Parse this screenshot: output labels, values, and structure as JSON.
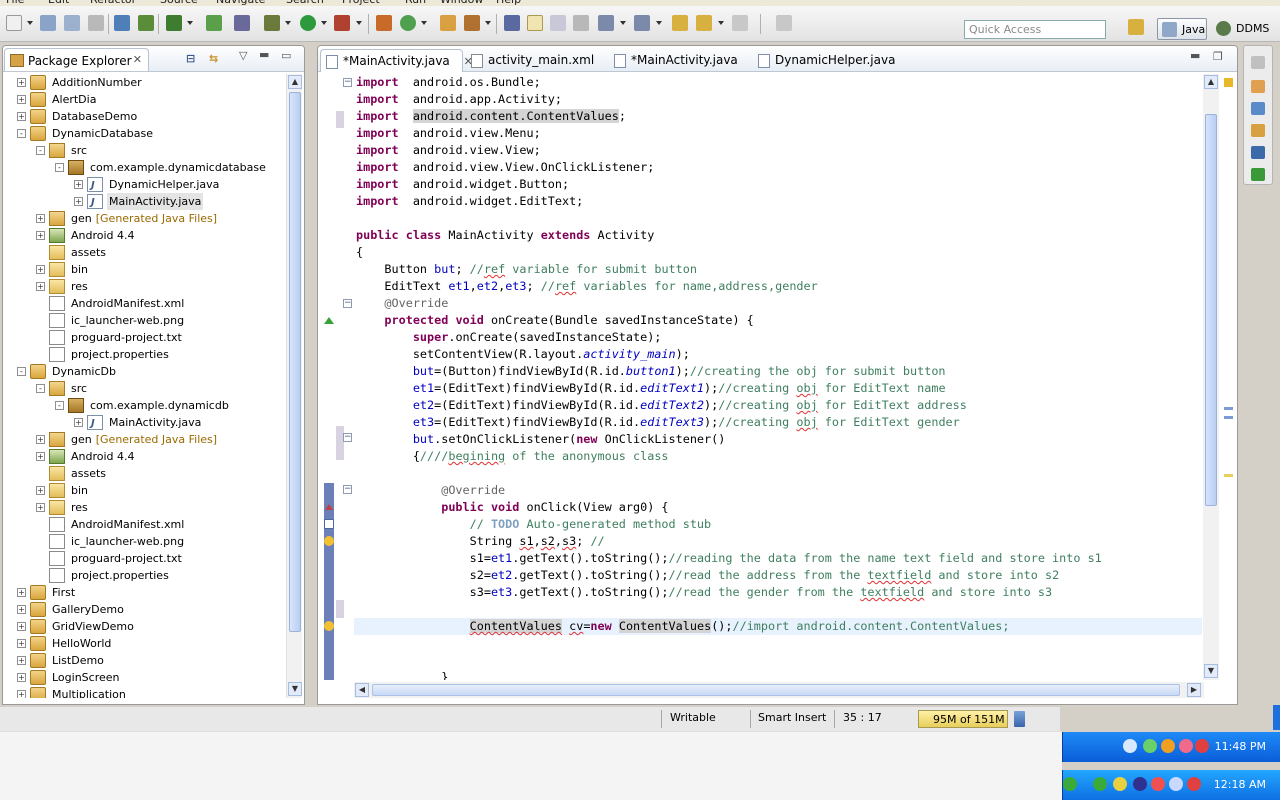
{
  "menubar": {
    "items": [
      "File",
      "Edit",
      "Refactor",
      "Source",
      "Navigate",
      "Search",
      "Project",
      "Run",
      "Window",
      "Help"
    ]
  },
  "toolbar": {
    "quick_access_placeholder": "Quick Access",
    "perspectives": [
      {
        "label": "Java"
      },
      {
        "label": "DDMS"
      }
    ]
  },
  "package_explorer": {
    "title": "Package Explorer",
    "rows": [
      {
        "label": "AdditionNumber",
        "indent": 0,
        "expander": "+",
        "icon": "project-icon"
      },
      {
        "label": "AlertDia",
        "indent": 0,
        "expander": "+",
        "icon": "project-icon"
      },
      {
        "label": "DatabaseDemo",
        "indent": 0,
        "expander": "+",
        "icon": "project-icon"
      },
      {
        "label": "DynamicDatabase",
        "indent": 0,
        "expander": "-",
        "icon": "project-icon"
      },
      {
        "label": "src",
        "indent": 1,
        "expander": "-",
        "icon": "source-folder-icon"
      },
      {
        "label": "com.example.dynamicdatabase",
        "indent": 2,
        "expander": "-",
        "icon": "package-icon"
      },
      {
        "label": "DynamicHelper.java",
        "indent": 3,
        "expander": "+",
        "icon": "java-file-icon"
      },
      {
        "label": "MainActivity.java",
        "indent": 3,
        "expander": "+",
        "icon": "java-file-icon",
        "selected": true
      },
      {
        "label": "gen",
        "extra": "[Generated Java Files]",
        "indent": 1,
        "expander": "+",
        "icon": "source-folder-icon"
      },
      {
        "label": "Android 4.4",
        "indent": 1,
        "expander": "+",
        "icon": "library-icon"
      },
      {
        "label": "assets",
        "indent": 1,
        "expander": "",
        "icon": "folder-icon"
      },
      {
        "label": "bin",
        "indent": 1,
        "expander": "+",
        "icon": "folder-icon"
      },
      {
        "label": "res",
        "indent": 1,
        "expander": "+",
        "icon": "folder-icon"
      },
      {
        "label": "AndroidManifest.xml",
        "indent": 1,
        "expander": "",
        "icon": "xml-file-icon"
      },
      {
        "label": "ic_launcher-web.png",
        "indent": 1,
        "expander": "",
        "icon": "image-file-icon"
      },
      {
        "label": "proguard-project.txt",
        "indent": 1,
        "expander": "",
        "icon": "text-file-icon"
      },
      {
        "label": "project.properties",
        "indent": 1,
        "expander": "",
        "icon": "text-file-icon"
      },
      {
        "label": "DynamicDb",
        "indent": 0,
        "expander": "-",
        "icon": "project-icon"
      },
      {
        "label": "src",
        "indent": 1,
        "expander": "-",
        "icon": "source-folder-icon"
      },
      {
        "label": "com.example.dynamicdb",
        "indent": 2,
        "expander": "-",
        "icon": "package-icon"
      },
      {
        "label": "MainActivity.java",
        "indent": 3,
        "expander": "+",
        "icon": "java-file-icon"
      },
      {
        "label": "gen",
        "extra": "[Generated Java Files]",
        "indent": 1,
        "expander": "+",
        "icon": "source-folder-icon"
      },
      {
        "label": "Android 4.4",
        "indent": 1,
        "expander": "+",
        "icon": "library-icon"
      },
      {
        "label": "assets",
        "indent": 1,
        "expander": "",
        "icon": "folder-icon"
      },
      {
        "label": "bin",
        "indent": 1,
        "expander": "+",
        "icon": "folder-icon"
      },
      {
        "label": "res",
        "indent": 1,
        "expander": "+",
        "icon": "folder-icon"
      },
      {
        "label": "AndroidManifest.xml",
        "indent": 1,
        "expander": "",
        "icon": "xml-file-icon"
      },
      {
        "label": "ic_launcher-web.png",
        "indent": 1,
        "expander": "",
        "icon": "image-file-icon"
      },
      {
        "label": "proguard-project.txt",
        "indent": 1,
        "expander": "",
        "icon": "text-file-icon"
      },
      {
        "label": "project.properties",
        "indent": 1,
        "expander": "",
        "icon": "text-file-icon"
      },
      {
        "label": "First",
        "indent": 0,
        "expander": "+",
        "icon": "project-icon"
      },
      {
        "label": "GalleryDemo",
        "indent": 0,
        "expander": "+",
        "icon": "project-icon"
      },
      {
        "label": "GridViewDemo",
        "indent": 0,
        "expander": "+",
        "icon": "project-icon"
      },
      {
        "label": "HelloWorld",
        "indent": 0,
        "expander": "+",
        "icon": "project-icon"
      },
      {
        "label": "ListDemo",
        "indent": 0,
        "expander": "+",
        "icon": "project-icon"
      },
      {
        "label": "LoginScreen",
        "indent": 0,
        "expander": "+",
        "icon": "project-icon"
      },
      {
        "label": "Multiplication",
        "indent": 0,
        "expander": "+",
        "icon": "project-icon"
      }
    ]
  },
  "editor": {
    "tabs": [
      {
        "label": "*MainActivity.java",
        "active": true,
        "icon": "java-file-icon",
        "close": "✕"
      },
      {
        "label": "activity_main.xml",
        "active": false,
        "icon": "xml-file-icon"
      },
      {
        "label": "*MainActivity.java",
        "active": false,
        "icon": "java-file-icon"
      },
      {
        "label": "DynamicHelper.java",
        "active": false,
        "icon": "java-file-icon"
      }
    ],
    "lines": [
      [
        [
          "kw",
          "import"
        ],
        [
          "",
          "  android.os.Bundle;"
        ]
      ],
      [
        [
          "kw",
          "import"
        ],
        [
          "",
          "  android.app.Activity;"
        ]
      ],
      [
        [
          "kw",
          "import"
        ],
        [
          "",
          "  "
        ],
        [
          "hl",
          "android.content.ContentValues"
        ],
        [
          "",
          ";"
        ]
      ],
      [
        [
          "kw",
          "import"
        ],
        [
          "",
          "  android.view.Menu;"
        ]
      ],
      [
        [
          "kw",
          "import"
        ],
        [
          "",
          "  android.view.View;"
        ]
      ],
      [
        [
          "kw",
          "import"
        ],
        [
          "",
          "  android.view.View.OnClickListener;"
        ]
      ],
      [
        [
          "kw",
          "import"
        ],
        [
          "",
          "  android.widget.Button;"
        ]
      ],
      [
        [
          "kw",
          "import"
        ],
        [
          "",
          "  android.widget.EditText;"
        ]
      ],
      [],
      [
        [
          "kw",
          "public"
        ],
        [
          "",
          " "
        ],
        [
          "kw",
          "class"
        ],
        [
          "",
          " MainActivity "
        ],
        [
          "kw",
          "extends"
        ],
        [
          "",
          " Activity"
        ]
      ],
      [
        [
          "",
          "{"
        ]
      ],
      [
        [
          "",
          "    Button "
        ],
        [
          "fld",
          "but"
        ],
        [
          "",
          "; "
        ],
        [
          "cm",
          "//"
        ],
        [
          "cm sp",
          "ref"
        ],
        [
          "cm",
          " variable for submit button"
        ]
      ],
      [
        [
          "",
          "    EditText "
        ],
        [
          "fld",
          "et1"
        ],
        [
          "",
          ","
        ],
        [
          "fld",
          "et2"
        ],
        [
          "",
          ","
        ],
        [
          "fld",
          "et3"
        ],
        [
          "",
          "; "
        ],
        [
          "cm",
          "//"
        ],
        [
          "cm sp",
          "ref"
        ],
        [
          "cm",
          " variables for name,address,gender"
        ]
      ],
      [
        [
          "ann",
          "    @Override"
        ]
      ],
      [
        [
          "kw",
          "    protected"
        ],
        [
          "",
          " "
        ],
        [
          "kw",
          "void"
        ],
        [
          "",
          " onCreate(Bundle savedInstanceState) {"
        ]
      ],
      [
        [
          "kw",
          "        super"
        ],
        [
          "",
          ".onCreate(savedInstanceState);"
        ]
      ],
      [
        [
          "",
          "        setContentView(R.layout."
        ],
        [
          "sfld",
          "activity_main"
        ],
        [
          "",
          ");"
        ]
      ],
      [
        [
          "fld",
          "        but"
        ],
        [
          "",
          "=(Button)findViewById(R.id."
        ],
        [
          "sfld",
          "button1"
        ],
        [
          "",
          ");"
        ],
        [
          "cm",
          "//creating the obj for submit button"
        ]
      ],
      [
        [
          "fld",
          "        et1"
        ],
        [
          "",
          "=(EditText)findViewById(R.id."
        ],
        [
          "sfld",
          "editText1"
        ],
        [
          "",
          ");"
        ],
        [
          "cm",
          "//creating "
        ],
        [
          "cm sp",
          "obj"
        ],
        [
          "cm",
          " for EditText name"
        ]
      ],
      [
        [
          "fld",
          "        et2"
        ],
        [
          "",
          "=(EditText)findViewById(R.id."
        ],
        [
          "sfld",
          "editText2"
        ],
        [
          "",
          ");"
        ],
        [
          "cm",
          "//creating "
        ],
        [
          "cm sp",
          "obj"
        ],
        [
          "cm",
          " for EditText address"
        ]
      ],
      [
        [
          "fld",
          "        et3"
        ],
        [
          "",
          "=(EditText)findViewById(R.id."
        ],
        [
          "sfld",
          "editText3"
        ],
        [
          "",
          ");"
        ],
        [
          "cm",
          "//creating "
        ],
        [
          "cm sp",
          "obj"
        ],
        [
          "cm",
          " for EditText gender"
        ]
      ],
      [
        [
          "fld",
          "        but"
        ],
        [
          "",
          ".setOnClickListener("
        ],
        [
          "kw",
          "new"
        ],
        [
          "",
          " OnClickListener()"
        ]
      ],
      [
        [
          "",
          "        {"
        ],
        [
          "cm",
          "////"
        ],
        [
          "cm sp",
          "begining"
        ],
        [
          "cm",
          " of the anonymous class"
        ]
      ],
      [],
      [
        [
          "ann",
          "            @Override"
        ]
      ],
      [
        [
          "kw",
          "            public"
        ],
        [
          "",
          " "
        ],
        [
          "kw",
          "void"
        ],
        [
          "",
          " onClick(View arg0) {"
        ]
      ],
      [
        [
          "cm",
          "                // "
        ],
        [
          "todo",
          "TODO"
        ],
        [
          "cm",
          " Auto-generated method stub"
        ]
      ],
      [
        [
          "",
          "                String "
        ],
        [
          "sp",
          "s1"
        ],
        [
          "",
          ","
        ],
        [
          "sp",
          "s2"
        ],
        [
          "",
          ","
        ],
        [
          "sp",
          "s3"
        ],
        [
          "",
          "; "
        ],
        [
          "cm",
          "//"
        ]
      ],
      [
        [
          "",
          "                s1="
        ],
        [
          "fld",
          "et1"
        ],
        [
          "",
          ".getText().toString();"
        ],
        [
          "cm",
          "//reading the data from the name text field and store into s1"
        ]
      ],
      [
        [
          "",
          "                s2="
        ],
        [
          "fld",
          "et2"
        ],
        [
          "",
          ".getText().toString();"
        ],
        [
          "cm",
          "//read the address from the "
        ],
        [
          "cm sp",
          "textfield"
        ],
        [
          "cm",
          " and store into s2"
        ]
      ],
      [
        [
          "",
          "                s3="
        ],
        [
          "fld",
          "et3"
        ],
        [
          "",
          ".getText().toString();"
        ],
        [
          "cm",
          "//read the gender from the "
        ],
        [
          "cm sp",
          "textfield"
        ],
        [
          "cm",
          " and store into s3"
        ]
      ],
      [],
      [
        [
          "",
          "                "
        ],
        [
          "hl sp",
          "ContentValues"
        ],
        [
          "",
          " "
        ],
        [
          "sp",
          "cv"
        ],
        [
          "",
          "="
        ],
        [
          "kw",
          "new"
        ],
        [
          "",
          " "
        ],
        [
          "hl",
          "ContentValues"
        ],
        [
          "",
          "();"
        ],
        [
          "cm",
          "//import android.content.ContentValues;"
        ]
      ],
      [],
      [],
      [
        [
          "",
          "            }"
        ]
      ]
    ],
    "current_line_index": 32
  },
  "status": {
    "writable": "Writable",
    "insert_mode": "Smart Insert",
    "position": "35 : 17",
    "heap": "95M of 151M"
  },
  "taskbar": {
    "clock_top": "11:48 PM",
    "clock_bottom": "12:18 AM"
  }
}
